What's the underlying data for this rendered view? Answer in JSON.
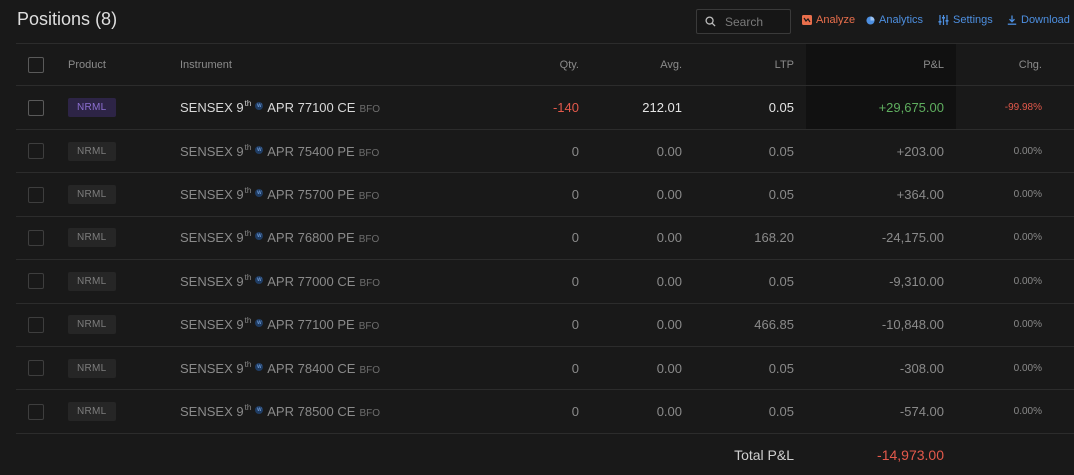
{
  "header": {
    "title": "Positions",
    "count": "(8)",
    "search_placeholder": "Search",
    "analyze_label": "Analyze",
    "analytics_label": "Analytics",
    "settings_label": "Settings",
    "download_label": "Download"
  },
  "columns": {
    "product": "Product",
    "instrument": "Instrument",
    "qty": "Qty.",
    "avg": "Avg.",
    "ltp": "LTP",
    "pnl": "P&L",
    "chg": "Chg."
  },
  "rows": [
    {
      "product": "NRML",
      "sym": "SENSEX 9",
      "sup": "th",
      "weekly": "w",
      "rest": "APR 77100 CE",
      "exch": "BFO",
      "qty": "-140",
      "avg": "212.01",
      "ltp": "0.05",
      "pnl": "+29,675.00",
      "chg": "-99.98%"
    },
    {
      "product": "NRML",
      "sym": "SENSEX 9",
      "sup": "th",
      "weekly": "w",
      "rest": "APR 75400 PE",
      "exch": "BFO",
      "qty": "0",
      "avg": "0.00",
      "ltp": "0.05",
      "pnl": "+203.00",
      "chg": "0.00%"
    },
    {
      "product": "NRML",
      "sym": "SENSEX 9",
      "sup": "th",
      "weekly": "w",
      "rest": "APR 75700 PE",
      "exch": "BFO",
      "qty": "0",
      "avg": "0.00",
      "ltp": "0.05",
      "pnl": "+364.00",
      "chg": "0.00%"
    },
    {
      "product": "NRML",
      "sym": "SENSEX 9",
      "sup": "th",
      "weekly": "w",
      "rest": "APR 76800 PE",
      "exch": "BFO",
      "qty": "0",
      "avg": "0.00",
      "ltp": "168.20",
      "pnl": "-24,175.00",
      "chg": "0.00%"
    },
    {
      "product": "NRML",
      "sym": "SENSEX 9",
      "sup": "th",
      "weekly": "w",
      "rest": "APR 77000 CE",
      "exch": "BFO",
      "qty": "0",
      "avg": "0.00",
      "ltp": "0.05",
      "pnl": "-9,310.00",
      "chg": "0.00%"
    },
    {
      "product": "NRML",
      "sym": "SENSEX 9",
      "sup": "th",
      "weekly": "w",
      "rest": "APR 77100 PE",
      "exch": "BFO",
      "qty": "0",
      "avg": "0.00",
      "ltp": "466.85",
      "pnl": "-10,848.00",
      "chg": "0.00%"
    },
    {
      "product": "NRML",
      "sym": "SENSEX 9",
      "sup": "th",
      "weekly": "w",
      "rest": "APR 78400 CE",
      "exch": "BFO",
      "qty": "0",
      "avg": "0.00",
      "ltp": "0.05",
      "pnl": "-308.00",
      "chg": "0.00%"
    },
    {
      "product": "NRML",
      "sym": "SENSEX 9",
      "sup": "th",
      "weekly": "w",
      "rest": "APR 78500 CE",
      "exch": "BFO",
      "qty": "0",
      "avg": "0.00",
      "ltp": "0.05",
      "pnl": "-574.00",
      "chg": "0.00%"
    }
  ],
  "total": {
    "label": "Total P&L",
    "value": "-14,973.00"
  },
  "colors": {
    "background": "#191919",
    "profit": "#5fae5f",
    "loss": "#e3594b",
    "accent_blue": "#4d8fe0",
    "accent_orange": "#e96f4c",
    "mis_badge": "#8c6fd1"
  }
}
